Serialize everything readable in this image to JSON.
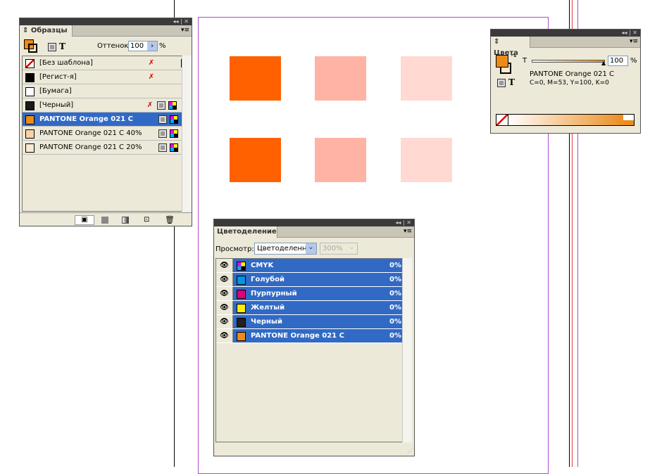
{
  "canvas": {
    "swatch_colors": [
      "#ff6000",
      "#ffb3a5",
      "#ffd9d2"
    ]
  },
  "swatches": {
    "title": "Образцы",
    "tint_label": "Оттенок:",
    "tint_value": "100",
    "percent": "%",
    "items": [
      {
        "name": "[Без шаблона]",
        "color": "none",
        "icons": [
          "no-edit-icon",
          "none-icon"
        ]
      },
      {
        "name": "[Регист-я]",
        "color": "#000000",
        "icons": [
          "no-edit-icon",
          "registration-icon"
        ]
      },
      {
        "name": "[Бумага]",
        "color": "#ffffff",
        "icons": []
      },
      {
        "name": "[Черный]",
        "color": "#1a1a1a",
        "icons": [
          "no-edit-icon",
          "process-icon",
          "cmyk-icon"
        ]
      },
      {
        "name": "PANTONE Orange 021 C",
        "color": "#ec8a1a",
        "icons": [
          "spot-icon",
          "cmyk-icon"
        ],
        "selected": true
      },
      {
        "name": "PANTONE Orange 021 C 40%",
        "color": "#f7d2a8",
        "icons": [
          "spot-icon",
          "cmyk-icon"
        ]
      },
      {
        "name": "PANTONE Orange 021 C 20%",
        "color": "#fbe8d2",
        "icons": [
          "spot-icon",
          "cmyk-icon"
        ]
      }
    ]
  },
  "colors": {
    "title": "Цвета",
    "t_label": "T",
    "tint_value": "100",
    "percent": "%",
    "color_name": "PANTONE Orange 021 C",
    "color_values": "C=0, M=53, Y=100, K=0",
    "accent": "#ec8a1a",
    "tint_fraction": 1.0
  },
  "separations": {
    "title": "Цветоделение",
    "view_label": "Просмотр:",
    "view_value": "Цветоделенные",
    "zoom_value": "300%",
    "items": [
      {
        "name": "CMYK",
        "value": "0%",
        "color": "cmyk"
      },
      {
        "name": "Голубой",
        "value": "0%",
        "color": "#0096e0"
      },
      {
        "name": "Пурпурный",
        "value": "0%",
        "color": "#e0007a"
      },
      {
        "name": "Желтый",
        "value": "0%",
        "color": "#ffee00"
      },
      {
        "name": "Черный",
        "value": "0%",
        "color": "#222222"
      },
      {
        "name": "PANTONE Orange 021 C",
        "value": "0%",
        "color": "#ec8a1a"
      }
    ]
  }
}
